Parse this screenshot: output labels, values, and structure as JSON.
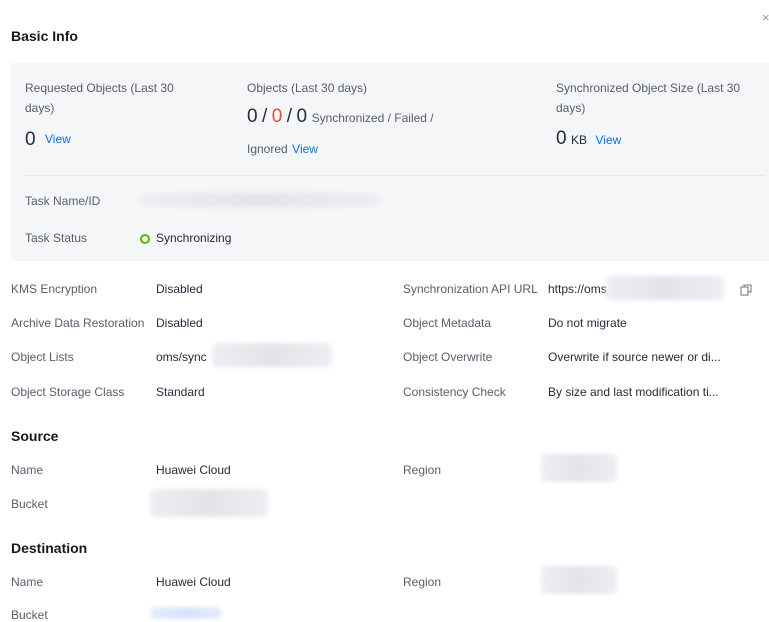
{
  "panel": {
    "close_glyph": "×"
  },
  "basic_info": {
    "title": "Basic Info",
    "requested": {
      "label_line1": "Requested Objects (Last 30",
      "label_line2": "days)",
      "value": "0",
      "link": "View"
    },
    "objects": {
      "label": "Objects (Last 30 days)",
      "synchronized": "0",
      "sep1": "/",
      "failed": "0",
      "sep2": "/",
      "ignored": "0",
      "legend_line1": "Synchronized / Failed /",
      "legend_line2": "Ignored",
      "link": "View"
    },
    "sync_size": {
      "label_line1": "Synchronized Object Size (Last 30",
      "label_line2": "days)",
      "value": "0",
      "unit": "KB",
      "link": "View"
    },
    "task_name_label": "Task Name/ID",
    "task_status_label": "Task Status",
    "task_status_value": "Synchronizing",
    "status_color": "#5cb300"
  },
  "details": {
    "kms_label": "KMS Encryption",
    "kms_value": "Disabled",
    "archive_label": "Archive Data Restoration",
    "archive_value": "Disabled",
    "lists_label": "Object Lists",
    "lists_value": "oms/sync",
    "storage_label": "Object Storage Class",
    "storage_value": "Standard",
    "api_label": "Synchronization API URL",
    "api_value": "https://oms",
    "metadata_label": "Object Metadata",
    "metadata_value": "Do not migrate",
    "overwrite_label": "Object Overwrite",
    "overwrite_value": "Overwrite if source newer or di...",
    "consistency_label": "Consistency Check",
    "consistency_value": "By size and last modification ti..."
  },
  "source": {
    "title": "Source",
    "name_label": "Name",
    "name_value": "Huawei Cloud",
    "region_label": "Region",
    "bucket_label": "Bucket"
  },
  "destination": {
    "title": "Destination",
    "name_label": "Name",
    "name_value": "Huawei Cloud",
    "region_label": "Region",
    "bucket_label": "Bucket"
  },
  "colors": {
    "accent": "#0c6fe5",
    "failed": "#e84a3e",
    "summary_bg": "#f5f6f8"
  }
}
